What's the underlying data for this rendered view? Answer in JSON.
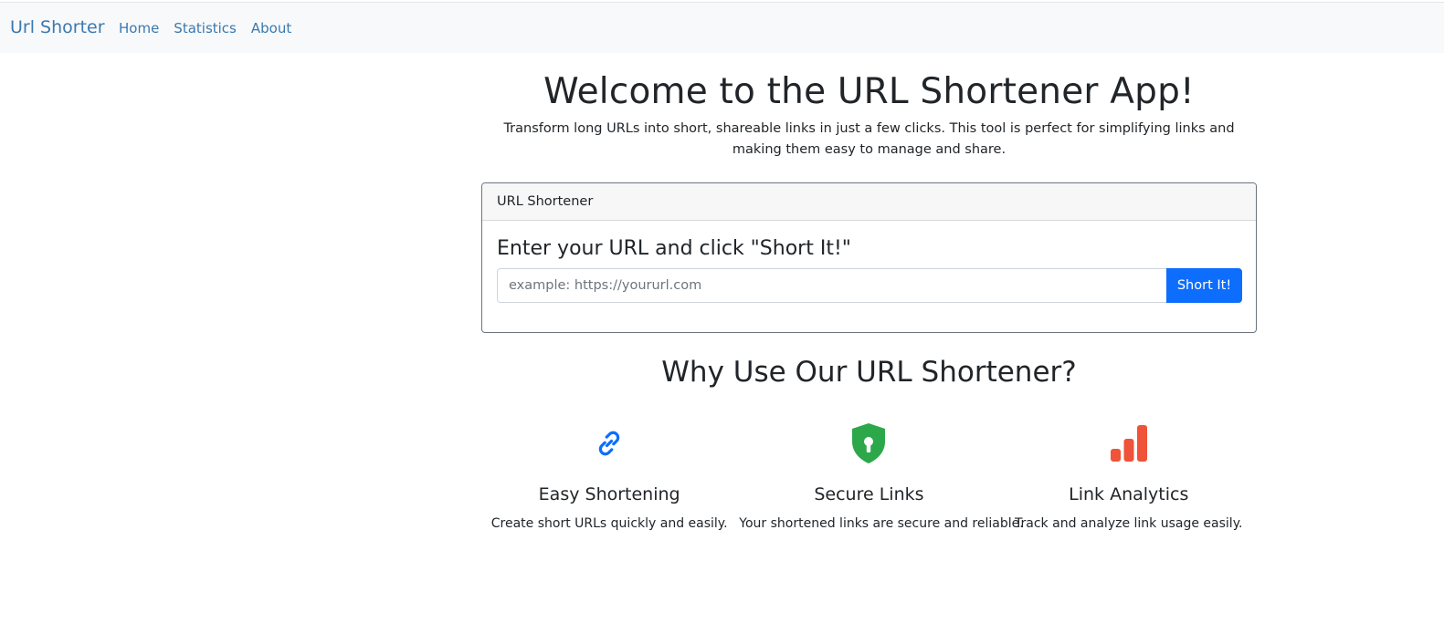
{
  "navbar": {
    "brand": "Url Shorter",
    "links": [
      {
        "label": "Home"
      },
      {
        "label": "Statistics"
      },
      {
        "label": "About"
      }
    ]
  },
  "hero": {
    "title": "Welcome to the URL Shortener App!",
    "lead": "Transform long URLs into short, shareable links in just a few clicks. This tool is perfect for simplifying links and making them easy to manage and share."
  },
  "card": {
    "header": "URL Shortener",
    "title": "Enter your URL and click \"Short It!\"",
    "input_value": "",
    "input_placeholder": "example: https://yoururl.com",
    "button_label": "Short It!"
  },
  "why": {
    "title": "Why Use Our URL Shortener?",
    "features": [
      {
        "icon": "link-icon",
        "icon_color": "#0d6efd",
        "title": "Easy Shortening",
        "text": "Create short URLs quickly and easily."
      },
      {
        "icon": "shield-lock-icon",
        "icon_color": "#2ca84a",
        "title": "Secure Links",
        "text": "Your shortened links are secure and reliable."
      },
      {
        "icon": "bar-chart-icon",
        "icon_color": "#ef5339",
        "title": "Link Analytics",
        "text": "Track and analyze link usage easily."
      }
    ]
  },
  "colors": {
    "brand_link": "#3a79b0",
    "primary": "#0d6efd",
    "navbar_bg": "#f8f9fa"
  }
}
